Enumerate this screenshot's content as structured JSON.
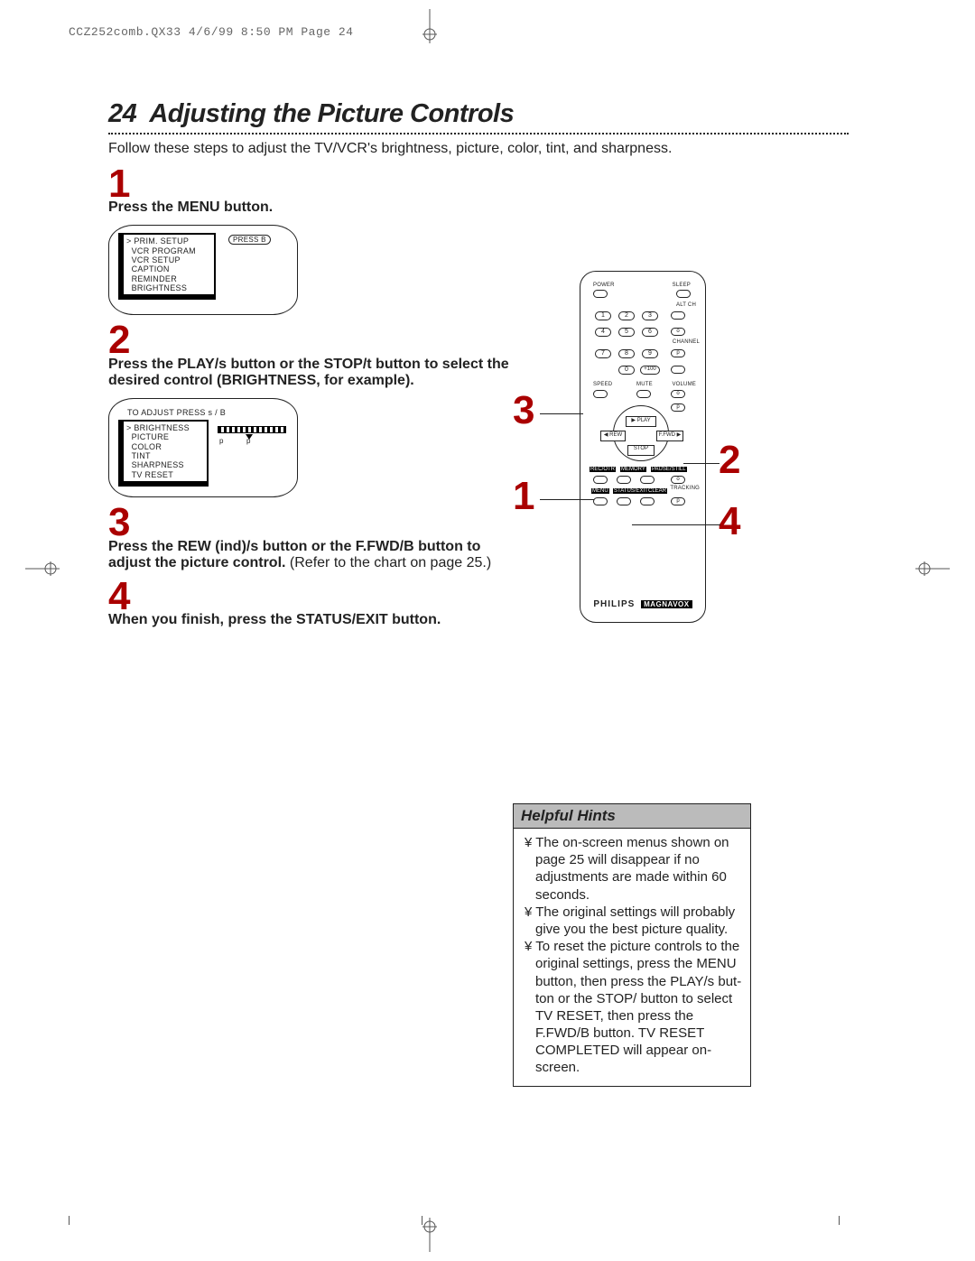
{
  "header": "CCZ252comb.QX33  4/6/99 8:50 PM  Page 24",
  "title_num": "24",
  "title_text": "Adjusting the Picture Controls",
  "intro": "Follow these steps to adjust the TV/VCR's brightness, picture, color, tint, and sharpness.",
  "steps": {
    "s1": {
      "num": "1",
      "text": "Press the MENU button."
    },
    "s2": {
      "num": "2",
      "text": "Press the PLAY/s  button or the STOP/t  button to select the desired control (BRIGHTNESS, for example)."
    },
    "s3": {
      "num": "3",
      "bold": "Press the REW (ind)/s  button or the F.FWD/B  button to adjust the picture control.",
      "rest": " (Refer to the chart on page 25.)"
    },
    "s4": {
      "num": "4",
      "text": "When you finish, press the STATUS/EXIT button."
    }
  },
  "screen1": {
    "items": [
      "PRIM. SETUP",
      "VCR PROGRAM",
      "VCR SETUP",
      "CAPTION",
      "REMINDER",
      "BRIGHTNESS"
    ],
    "press_label": "PRESS B"
  },
  "screen2": {
    "header": "TO ADJUST PRESS s / B",
    "items": [
      "BRIGHTNESS",
      "PICTURE",
      "COLOR",
      "TINT",
      "SHARPNESS",
      "TV RESET"
    ]
  },
  "remote": {
    "power": "POWER",
    "sleep": "SLEEP",
    "altch": "ALT CH",
    "channel": "CHANNEL",
    "speed": "SPEED",
    "mute": "MUTE",
    "volume": "VOLUME",
    "play": "PLAY",
    "rew": "REW",
    "ffwd": "F.FWD",
    "stop": "STOP",
    "recotr": "REC/OTR",
    "memory": "MEMORY",
    "pause": "PAUSE/STILL",
    "menu": "MENU",
    "status": "STATUS/EXIT",
    "clear": "CLEAR",
    "tracking": "TRACKING",
    "brand": "PHILIPS",
    "brand2": "MAGNAVOX",
    "plus100": "+100"
  },
  "callouts": {
    "c1": "1",
    "c2": "2",
    "c3": "3",
    "c4": "4"
  },
  "hints": {
    "title": "Helpful Hints",
    "items": [
      "¥  The on-screen menus shown on page 25 will disappear if no adjustments are made within 60 seconds.",
      "¥  The original settings will probably give you the best picture quality.",
      "¥  To reset the picture controls to the original settings, press the MENU button, then press the PLAY/s but-ton or the STOP/ button to select TV RESET, then press the F.FWD/B  button. TV RESET COMPLETED will appear on-screen."
    ]
  }
}
